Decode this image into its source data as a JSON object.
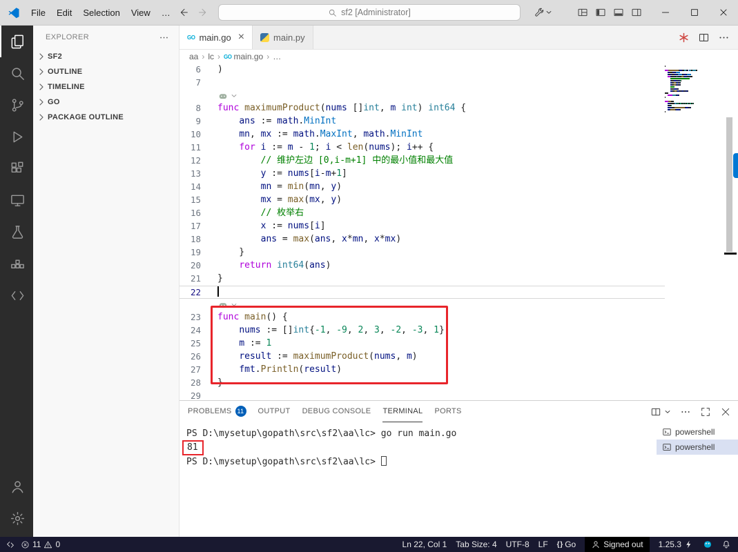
{
  "titlebar": {
    "menus": [
      "File",
      "Edit",
      "Selection",
      "View"
    ],
    "overflow": "…",
    "search": "sf2 [Administrator]"
  },
  "activitybar": {
    "top": [
      "explorer",
      "search",
      "source-control",
      "run-debug",
      "extensions",
      "remote-explorer",
      "testing",
      "containers",
      "snippets"
    ],
    "active": "explorer",
    "bottom": [
      "account",
      "settings"
    ]
  },
  "sidebar": {
    "title": "EXPLORER",
    "sections": [
      "SF2",
      "OUTLINE",
      "TIMELINE",
      "GO",
      "PACKAGE OUTLINE"
    ]
  },
  "editor": {
    "tabs": [
      {
        "label": "main.go",
        "icon": "go",
        "active": true,
        "close_visible": true
      },
      {
        "label": "main.py",
        "icon": "python",
        "active": false,
        "close_visible": false
      }
    ],
    "breadcrumbs": [
      {
        "label": "aa"
      },
      {
        "label": "lc"
      },
      {
        "label": "main.go",
        "icon": "go"
      },
      {
        "label": "…"
      }
    ],
    "token_colors": {
      "kw": "#af00db",
      "fn": "#795e26",
      "var": "#001080",
      "const": "#0070c1",
      "type": "#267f99",
      "num": "#098658",
      "com": "#008000",
      "def": "#1e1e1e"
    },
    "cursor_line": "Ln 22, Col 1",
    "lines": [
      {
        "n": 6,
        "s": [
          [
            ")",
            "def"
          ]
        ]
      },
      {
        "n": 7,
        "s": []
      },
      {
        "lens": true
      },
      {
        "n": 8,
        "s": [
          [
            "func ",
            "kw"
          ],
          [
            "maximumProduct",
            "fn"
          ],
          [
            "(",
            "def"
          ],
          [
            "nums",
            "var"
          ],
          [
            " []",
            "def"
          ],
          [
            "int",
            "type"
          ],
          [
            ", ",
            "def"
          ],
          [
            "m",
            "var"
          ],
          [
            " ",
            "def"
          ],
          [
            "int",
            "type"
          ],
          [
            ") ",
            "def"
          ],
          [
            "int64",
            "type"
          ],
          [
            " {",
            "def"
          ]
        ]
      },
      {
        "n": 9,
        "s": [
          [
            "    ",
            "def"
          ],
          [
            "ans",
            "var"
          ],
          [
            " := ",
            "def"
          ],
          [
            "math",
            "var"
          ],
          [
            ".",
            "def"
          ],
          [
            "MinInt",
            "const"
          ]
        ]
      },
      {
        "n": 10,
        "s": [
          [
            "    ",
            "def"
          ],
          [
            "mn",
            "var"
          ],
          [
            ", ",
            "def"
          ],
          [
            "mx",
            "var"
          ],
          [
            " := ",
            "def"
          ],
          [
            "math",
            "var"
          ],
          [
            ".",
            "def"
          ],
          [
            "MaxInt",
            "const"
          ],
          [
            ", ",
            "def"
          ],
          [
            "math",
            "var"
          ],
          [
            ".",
            "def"
          ],
          [
            "MinInt",
            "const"
          ]
        ]
      },
      {
        "n": 11,
        "s": [
          [
            "    ",
            "def"
          ],
          [
            "for ",
            "kw"
          ],
          [
            "i",
            "var"
          ],
          [
            " := ",
            "def"
          ],
          [
            "m",
            "var"
          ],
          [
            " - ",
            "def"
          ],
          [
            "1",
            "num"
          ],
          [
            "; ",
            "def"
          ],
          [
            "i",
            "var"
          ],
          [
            " < ",
            "def"
          ],
          [
            "len",
            "fn"
          ],
          [
            "(",
            "def"
          ],
          [
            "nums",
            "var"
          ],
          [
            "); ",
            "def"
          ],
          [
            "i",
            "var"
          ],
          [
            "++ {",
            "def"
          ]
        ]
      },
      {
        "n": 12,
        "s": [
          [
            "        ",
            "def"
          ],
          [
            "// 维护左边 [0,i-m+1] 中的最小值和最大值",
            "com"
          ]
        ]
      },
      {
        "n": 13,
        "s": [
          [
            "        ",
            "def"
          ],
          [
            "y",
            "var"
          ],
          [
            " := ",
            "def"
          ],
          [
            "nums",
            "var"
          ],
          [
            "[",
            "def"
          ],
          [
            "i",
            "var"
          ],
          [
            "-",
            "def"
          ],
          [
            "m",
            "var"
          ],
          [
            "+",
            "def"
          ],
          [
            "1",
            "num"
          ],
          [
            "]",
            "def"
          ]
        ]
      },
      {
        "n": 14,
        "s": [
          [
            "        ",
            "def"
          ],
          [
            "mn",
            "var"
          ],
          [
            " = ",
            "def"
          ],
          [
            "min",
            "fn"
          ],
          [
            "(",
            "def"
          ],
          [
            "mn",
            "var"
          ],
          [
            ", ",
            "def"
          ],
          [
            "y",
            "var"
          ],
          [
            ")",
            "def"
          ]
        ]
      },
      {
        "n": 15,
        "s": [
          [
            "        ",
            "def"
          ],
          [
            "mx",
            "var"
          ],
          [
            " = ",
            "def"
          ],
          [
            "max",
            "fn"
          ],
          [
            "(",
            "def"
          ],
          [
            "mx",
            "var"
          ],
          [
            ", ",
            "def"
          ],
          [
            "y",
            "var"
          ],
          [
            ")",
            "def"
          ]
        ]
      },
      {
        "n": 16,
        "s": [
          [
            "        ",
            "def"
          ],
          [
            "// 枚举右",
            "com"
          ]
        ]
      },
      {
        "n": 17,
        "s": [
          [
            "        ",
            "def"
          ],
          [
            "x",
            "var"
          ],
          [
            " := ",
            "def"
          ],
          [
            "nums",
            "var"
          ],
          [
            "[",
            "def"
          ],
          [
            "i",
            "var"
          ],
          [
            "]",
            "def"
          ]
        ]
      },
      {
        "n": 18,
        "s": [
          [
            "        ",
            "def"
          ],
          [
            "ans",
            "var"
          ],
          [
            " = ",
            "def"
          ],
          [
            "max",
            "fn"
          ],
          [
            "(",
            "def"
          ],
          [
            "ans",
            "var"
          ],
          [
            ", ",
            "def"
          ],
          [
            "x",
            "var"
          ],
          [
            "*",
            "def"
          ],
          [
            "mn",
            "var"
          ],
          [
            ", ",
            "def"
          ],
          [
            "x",
            "var"
          ],
          [
            "*",
            "def"
          ],
          [
            "mx",
            "var"
          ],
          [
            ")",
            "def"
          ]
        ]
      },
      {
        "n": 19,
        "s": [
          [
            "    }",
            "def"
          ]
        ]
      },
      {
        "n": 20,
        "s": [
          [
            "    ",
            "def"
          ],
          [
            "return ",
            "kw"
          ],
          [
            "int64",
            "type"
          ],
          [
            "(",
            "def"
          ],
          [
            "ans",
            "var"
          ],
          [
            ")",
            "def"
          ]
        ]
      },
      {
        "n": 21,
        "s": [
          [
            "}",
            "def"
          ]
        ]
      },
      {
        "n": 22,
        "s": [],
        "current": true,
        "cursor": true
      },
      {
        "lens": true
      },
      {
        "n": 23,
        "s": [
          [
            "func ",
            "kw"
          ],
          [
            "main",
            "fn"
          ],
          [
            "() {",
            "def"
          ]
        ]
      },
      {
        "n": 24,
        "s": [
          [
            "    ",
            "def"
          ],
          [
            "nums",
            "var"
          ],
          [
            " := []",
            "def"
          ],
          [
            "int",
            "type"
          ],
          [
            "{",
            "def"
          ],
          [
            "-1",
            "num"
          ],
          [
            ", ",
            "def"
          ],
          [
            "-9",
            "num"
          ],
          [
            ", ",
            "def"
          ],
          [
            "2",
            "num"
          ],
          [
            ", ",
            "def"
          ],
          [
            "3",
            "num"
          ],
          [
            ", ",
            "def"
          ],
          [
            "-2",
            "num"
          ],
          [
            ", ",
            "def"
          ],
          [
            "-3",
            "num"
          ],
          [
            ", ",
            "def"
          ],
          [
            "1",
            "num"
          ],
          [
            "}",
            "def"
          ]
        ]
      },
      {
        "n": 25,
        "s": [
          [
            "    ",
            "def"
          ],
          [
            "m",
            "var"
          ],
          [
            " := ",
            "def"
          ],
          [
            "1",
            "num"
          ]
        ]
      },
      {
        "n": 26,
        "s": [
          [
            "    ",
            "def"
          ],
          [
            "result",
            "var"
          ],
          [
            " := ",
            "def"
          ],
          [
            "maximumProduct",
            "fn"
          ],
          [
            "(",
            "def"
          ],
          [
            "nums",
            "var"
          ],
          [
            ", ",
            "def"
          ],
          [
            "m",
            "var"
          ],
          [
            ")",
            "def"
          ]
        ]
      },
      {
        "n": 27,
        "s": [
          [
            "    ",
            "def"
          ],
          [
            "fmt",
            "var"
          ],
          [
            ".",
            "def"
          ],
          [
            "Println",
            "fn"
          ],
          [
            "(",
            "def"
          ],
          [
            "result",
            "var"
          ],
          [
            ")",
            "def"
          ]
        ]
      },
      {
        "n": 28,
        "s": [
          [
            "}",
            "def"
          ]
        ]
      },
      {
        "n": 29,
        "s": []
      }
    ]
  },
  "annotations": {
    "editor_box_lines": "23-28",
    "terminal_box_text": "81",
    "red": "#e8252b"
  },
  "panel": {
    "tabs": [
      {
        "label": "PROBLEMS",
        "badge": "11"
      },
      {
        "label": "OUTPUT"
      },
      {
        "label": "DEBUG CONSOLE"
      },
      {
        "label": "TERMINAL",
        "active": true
      },
      {
        "label": "PORTS"
      }
    ],
    "terminal": {
      "lines": [
        {
          "s": [
            [
              "PS D:\\mysetup\\gopath\\src\\sf2\\aa\\lc> ",
              "def"
            ],
            [
              "go run main.go",
              "def"
            ]
          ]
        },
        {
          "s": [
            [
              "81",
              "def"
            ]
          ],
          "boxed": true
        },
        {
          "s": [
            [
              "PS D:\\mysetup\\gopath\\src\\sf2\\aa\\lc> ",
              "def"
            ]
          ],
          "cursor": true
        }
      ],
      "list": [
        {
          "label": "powershell",
          "selected": false
        },
        {
          "label": "powershell",
          "selected": true
        }
      ]
    }
  },
  "statusbar": {
    "errors": "11",
    "warnings": "0",
    "ln_col": "Ln 22, Col 1",
    "tab_size": "Tab Size: 4",
    "encoding": "UTF-8",
    "eol": "LF",
    "language": "Go",
    "sign_status": "Signed out",
    "go_version": "1.25.3"
  },
  "colors": {
    "accent": "#0078d4",
    "badge": "#005fb8",
    "annotation_red": "#e8252b",
    "statusbar_bg": "#191930"
  }
}
